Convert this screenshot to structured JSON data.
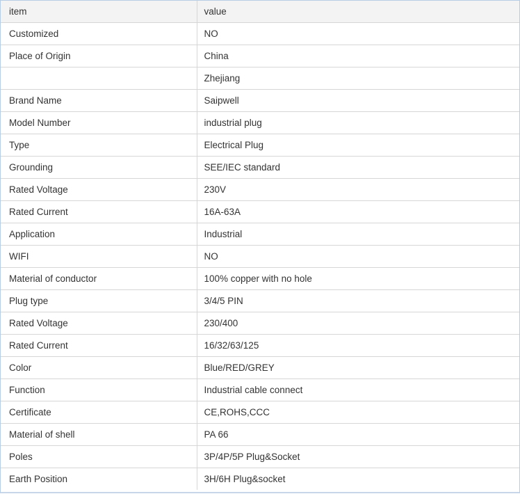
{
  "table": {
    "header": {
      "item": "item",
      "value": "value"
    },
    "rows": [
      {
        "item": "Customized",
        "value": "NO"
      },
      {
        "item": "Place of Origin",
        "value": "China"
      },
      {
        "item": "",
        "value": "Zhejiang"
      },
      {
        "item": "Brand Name",
        "value": "Saipwell"
      },
      {
        "item": "Model Number",
        "value": "industrial plug"
      },
      {
        "item": "Type",
        "value": "Electrical Plug"
      },
      {
        "item": "Grounding",
        "value": "SEE/IEC standard"
      },
      {
        "item": "Rated Voltage",
        "value": "230V"
      },
      {
        "item": "Rated Current",
        "value": "16A-63A"
      },
      {
        "item": "Application",
        "value": "Industrial"
      },
      {
        "item": "WIFI",
        "value": "NO"
      },
      {
        "item": "Material of conductor",
        "value": "100% copper with no hole"
      },
      {
        "item": "Plug type",
        "value": "3/4/5 PIN"
      },
      {
        "item": "Rated Voltage",
        "value": "230/400"
      },
      {
        "item": "Rated Current",
        "value": "16/32/63/125"
      },
      {
        "item": "Color",
        "value": "Blue/RED/GREY"
      },
      {
        "item": "Function",
        "value": "Industrial cable connect"
      },
      {
        "item": "Certificate",
        "value": "CE,ROHS,CCC"
      },
      {
        "item": "Material of shell",
        "value": "PA 66"
      },
      {
        "item": "Poles",
        "value": "3P/4P/5P Plug&Socket"
      },
      {
        "item": "Earth Position",
        "value": "3H/6H Plug&socket"
      }
    ]
  },
  "colors": {
    "header_background": "#f3f3f3",
    "border": "#d6d6d6",
    "frame_border": "#b7cde6",
    "text": "#333333"
  }
}
